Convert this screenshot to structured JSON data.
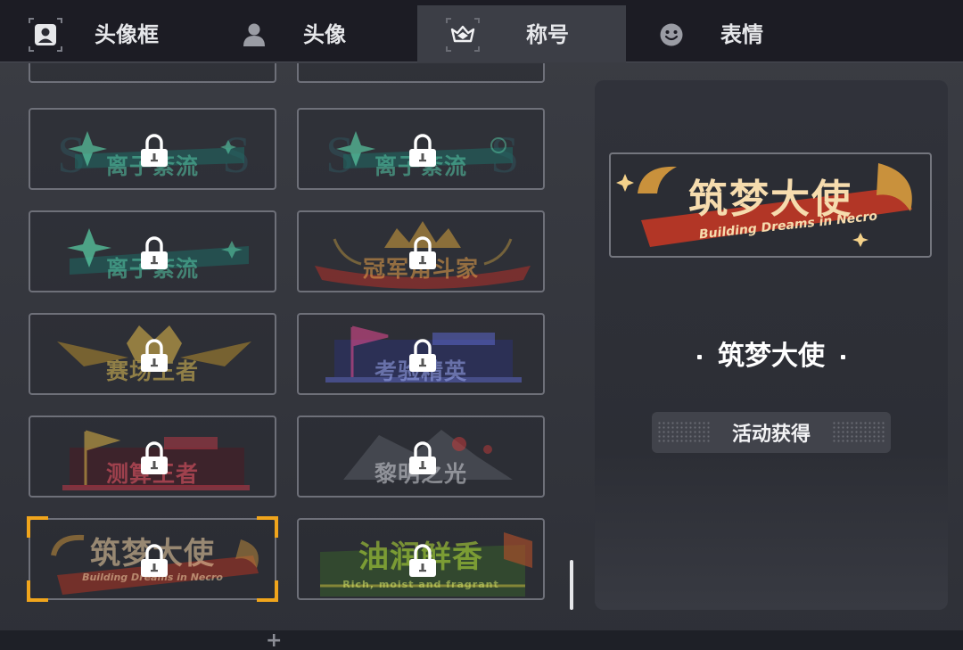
{
  "tabs": [
    {
      "label": "头像框",
      "icon": "avatar-frame-icon"
    },
    {
      "label": "头像",
      "icon": "person-icon"
    },
    {
      "label": "称号",
      "icon": "title-crown-icon",
      "active": true
    },
    {
      "label": "表情",
      "icon": "smiley-icon"
    }
  ],
  "titles": [
    {
      "name": "离子紊流",
      "color": "#55c9a7",
      "locked": true
    },
    {
      "name": "离子紊流",
      "color": "#55c9a7",
      "locked": true
    },
    {
      "name": "离子紊流",
      "color": "#55c9a7",
      "locked": true
    },
    {
      "name": "冠军角斗家",
      "color": "#e9a24a",
      "locked": true
    },
    {
      "name": "赛场王者",
      "color": "#e2c155",
      "locked": true
    },
    {
      "name": "考验精英",
      "color": "#9aa7ee",
      "locked": true
    },
    {
      "name": "测算王者",
      "color": "#f05a6a",
      "locked": true
    },
    {
      "name": "黎明之光",
      "color": "#d0d2d8",
      "locked": true
    },
    {
      "name": "筑梦大使",
      "sub": "Building Dreams in Necro",
      "color": "#f3d3a6",
      "locked": true,
      "selected": true
    },
    {
      "name": "油润鲜香",
      "sub": "Rich, moist and fragrant",
      "color": "#b8e23a",
      "locked": true
    }
  ],
  "detail": {
    "banner_title": "筑梦大使",
    "banner_sub": "Building Dreams in Necro",
    "name": "筑梦大使",
    "source": "活动获得"
  },
  "colors": {
    "accent_selected": "#f0a51c",
    "tab_active": "#3c3e46",
    "tab_bar": "#1c1c24"
  }
}
